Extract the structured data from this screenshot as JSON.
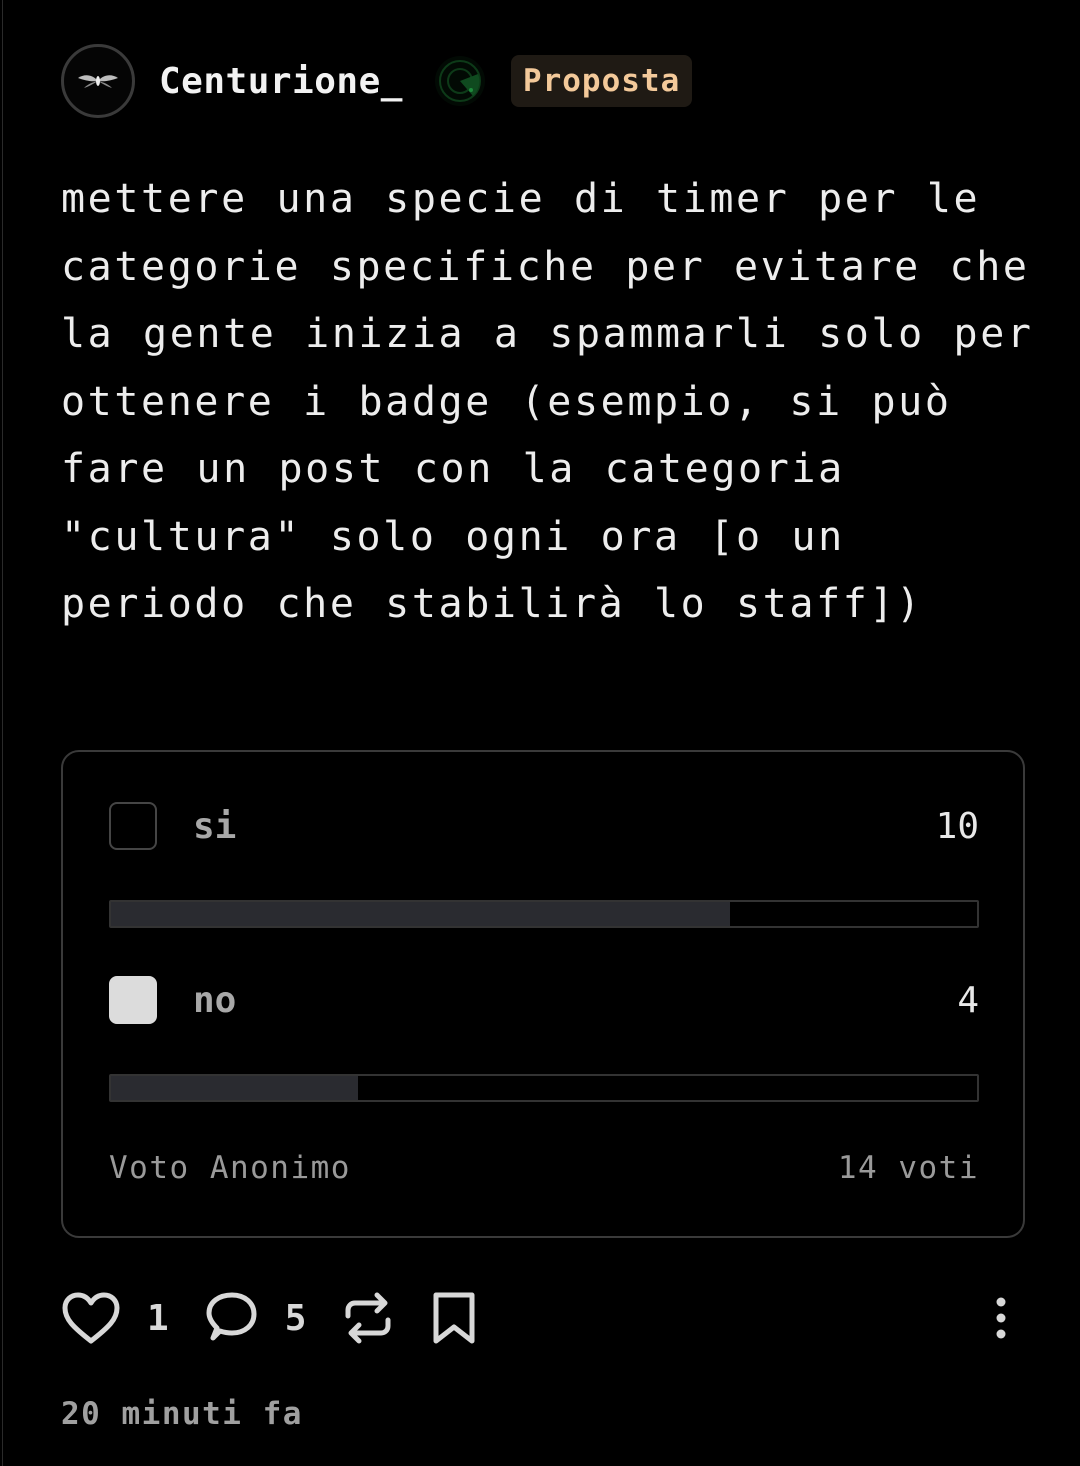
{
  "post": {
    "author": "Centurione_",
    "avatar_icon": "moth-icon",
    "badge_icon": "radar-badge-icon",
    "category_tag": "Proposta",
    "text": "mettere una specie di timer per le categorie specifiche per evitare che la gente inizia a spammarli solo per ottenere i badge (esempio, si può fare un post con la categoria \"cultura\" solo ogni ora [o un periodo che stabilirà lo staff])",
    "timestamp": "20 minuti fa"
  },
  "poll": {
    "options": [
      {
        "label": "si",
        "count": "10",
        "fraction": 0.7143,
        "selected": false
      },
      {
        "label": "no",
        "count": "4",
        "fraction": 0.2857,
        "selected": true
      }
    ],
    "mode_label": "Voto Anonimo",
    "total_label": "14 voti"
  },
  "actions": {
    "like_icon": "heart-icon",
    "like_count": "1",
    "comment_icon": "comment-icon",
    "comment_count": "5",
    "repost_icon": "repost-icon",
    "bookmark_icon": "bookmark-icon",
    "more_icon": "more-vertical-icon"
  },
  "colors": {
    "background": "#000000",
    "tag_text": "#f3c99a",
    "tag_background": "#1f1a14",
    "bar_fill": "#2a2b30"
  }
}
